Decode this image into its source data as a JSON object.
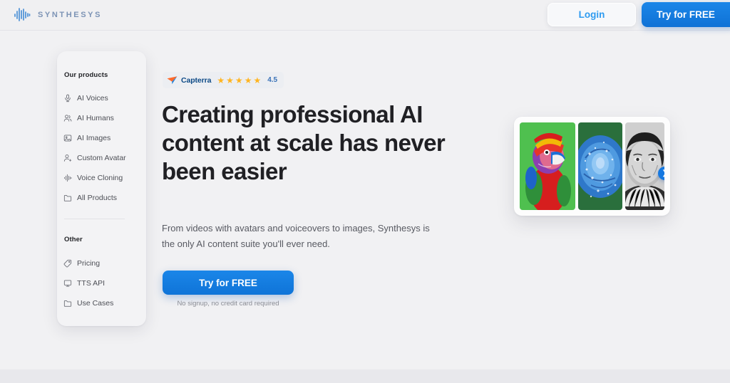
{
  "header": {
    "brand_name": "SYNTHESYS",
    "brand_icon": "waveform-logo-icon",
    "login_label": "Login",
    "try_label": "Try for FREE"
  },
  "sidebar": {
    "products_heading": "Our products",
    "other_heading": "Other",
    "products": [
      {
        "label": "AI Voices",
        "icon": "microphone-icon"
      },
      {
        "label": "AI Humans",
        "icon": "people-icon"
      },
      {
        "label": "AI Images",
        "icon": "image-icon"
      },
      {
        "label": "Custom Avatar",
        "icon": "person-add-icon"
      },
      {
        "label": "Voice Cloning",
        "icon": "waveform-icon"
      },
      {
        "label": "All Products",
        "icon": "folder-icon"
      }
    ],
    "other": [
      {
        "label": "Pricing",
        "icon": "tag-icon"
      },
      {
        "label": "TTS API",
        "icon": "monitor-icon"
      },
      {
        "label": "Use Cases",
        "icon": "folder-icon"
      }
    ]
  },
  "hero": {
    "badge": {
      "logo_icon": "capterra-arrow-icon",
      "name": "Capterra",
      "stars": "★★★★★",
      "score": "4.5"
    },
    "headline": "Creating professional AI content at scale has never been easier",
    "subtext": "From videos with avatars and voiceovers to images, Synthesys is the only AI content suite you'll ever need.",
    "cta_label": "Try for FREE",
    "cta_note": "No signup, no credit card required"
  },
  "carousel": {
    "slides": [
      {
        "name": "parrot-image",
        "alt": "Colorful macaw parrot on green background"
      },
      {
        "name": "blue-rose-image",
        "alt": "Blue rose with dew drops"
      },
      {
        "name": "portrait-image",
        "alt": "Black and white portrait of an elderly woman"
      }
    ],
    "next_icon": "chevron-right-icon"
  },
  "colors": {
    "accent_blue": "#1578e0",
    "login_blue": "#2e9bf0",
    "star_gold": "#ffb521",
    "page_bg": "#f1f1f3"
  }
}
